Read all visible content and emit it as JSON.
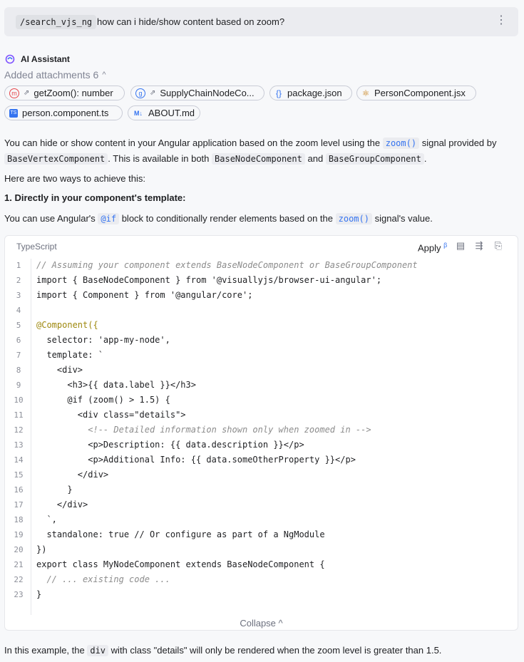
{
  "query": {
    "command": "/search_vjs_ng",
    "text": "how can i hide/show content based on zoom?"
  },
  "assistant": {
    "name": "AI Assistant"
  },
  "attachments": {
    "label": "Added attachments 6",
    "items": [
      {
        "label": "getZoom(): number",
        "icon": "method-icon",
        "color": "#e5484d"
      },
      {
        "label": "SupplyChainNodeCo...",
        "icon": "angular-ts-icon",
        "color": "#3574f0"
      },
      {
        "label": "package.json",
        "icon": "json-braces-icon",
        "color": "#3574f0"
      },
      {
        "label": "PersonComponent.jsx",
        "icon": "react-icon",
        "color": "#c77d10"
      },
      {
        "label": "person.component.ts",
        "icon": "typescript-icon",
        "color": "#3574f0"
      },
      {
        "label": "ABOUT.md",
        "icon": "markdown-icon",
        "color": "#3574f0"
      }
    ]
  },
  "intro": {
    "p1a": "You can hide or show content in your Angular application based on the zoom level using the",
    "p1_zoom": "zoom()",
    "p1b": "signal provided by",
    "p1_base": "BaseVertexComponent",
    "p1c": ". This is available in both",
    "p1_node": "BaseNodeComponent",
    "p1_and": "and",
    "p1_group": "BaseGroupComponent",
    "p1_end": ".",
    "p2": "Here are two ways to achieve this:",
    "heading": "1. Directly in your component's template:",
    "p3a": "You can use Angular's",
    "p3_if": "@if",
    "p3b": "block to conditionally render elements based on the",
    "p3_zoom": "zoom()",
    "p3c": "signal's value."
  },
  "code": {
    "language": "TypeScript",
    "apply_label": "Apply",
    "apply_badge": "β",
    "collapse_label": "Collapse",
    "lines": [
      "// Assuming your component extends BaseNodeComponent or BaseGroupComponent",
      "import { BaseNodeComponent } from '@visuallyjs/browser-ui-angular';",
      "import { Component } from '@angular/core';",
      "",
      "@Component({",
      "  selector: 'app-my-node',",
      "  template: `",
      "    <div>",
      "      <h3>{{ data.label }}</h3>",
      "      @if (zoom() > 1.5) {",
      "        <div class=\"details\">",
      "          <!-- Detailed information shown only when zoomed in -->",
      "          <p>Description: {{ data.description }}</p>",
      "          <p>Additional Info: {{ data.someOtherProperty }}</p>",
      "        </div>",
      "      }",
      "    </div>",
      "  `,",
      "  standalone: true // Or configure as part of a NgModule",
      "})",
      "export class MyNodeComponent extends BaseNodeComponent {",
      "  // ... existing code ...",
      "}"
    ]
  },
  "footer": {
    "a": "In this example, the",
    "code": "div",
    "b": "with class \"details\" will only be rendered when the zoom level is greater than 1.5."
  }
}
